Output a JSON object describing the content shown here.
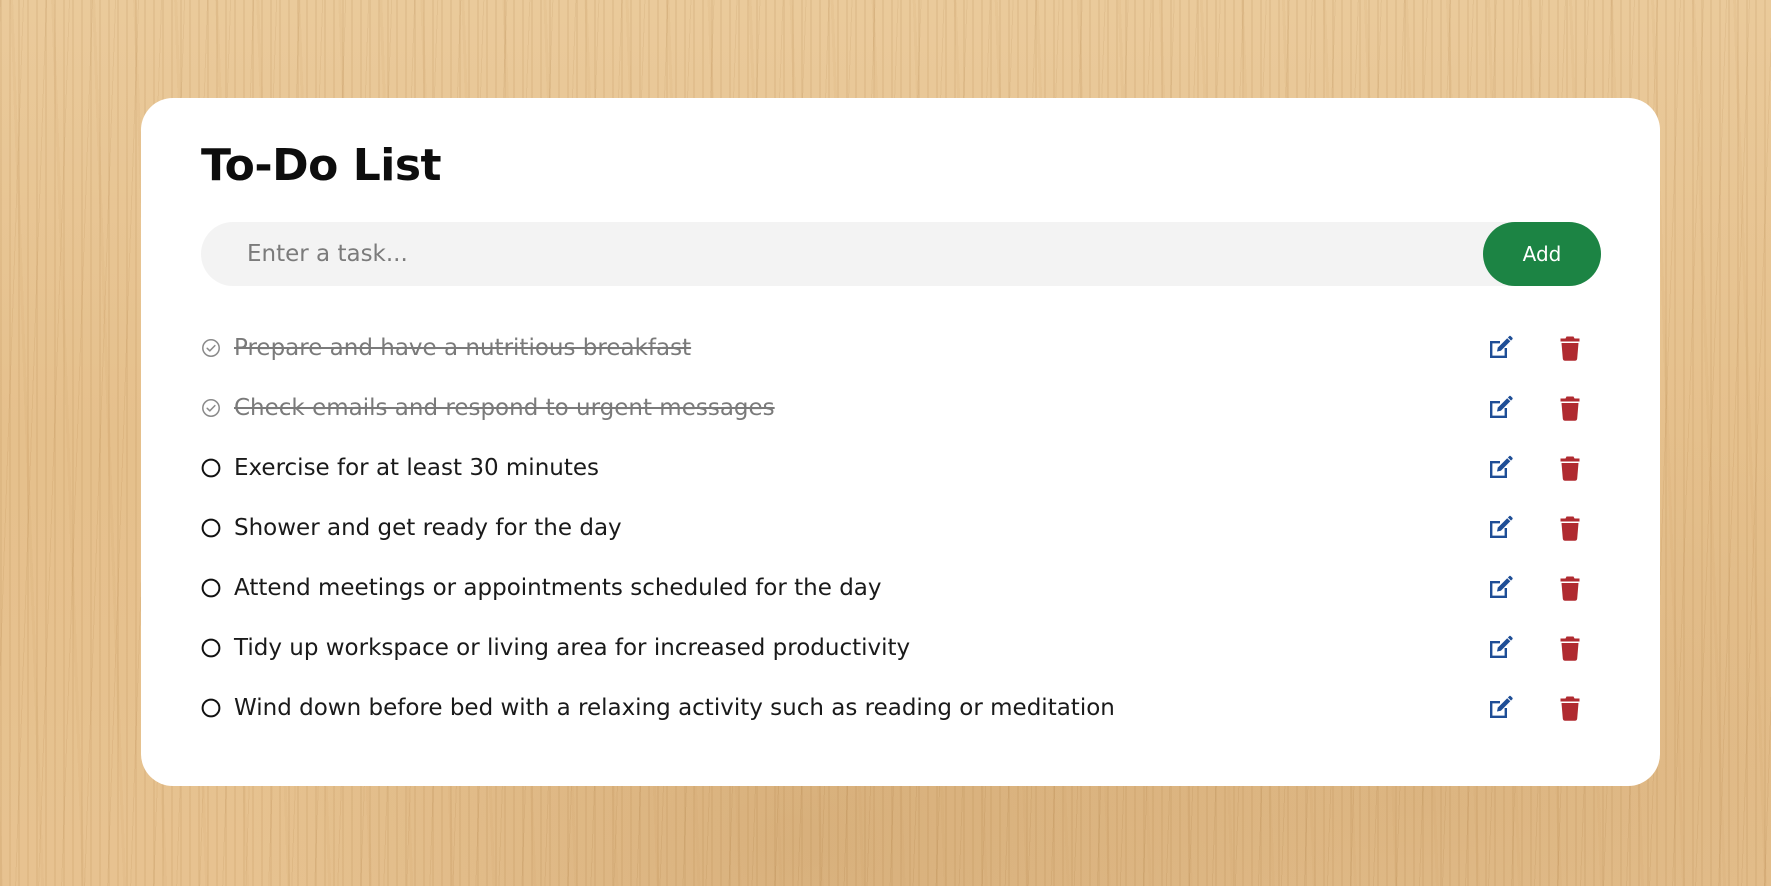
{
  "app": {
    "title": "To-Do List"
  },
  "new_task": {
    "placeholder": "Enter a task...",
    "value": "",
    "add_label": "Add"
  },
  "colors": {
    "accent": "#1c8444",
    "edit_icon": "#1f4e96",
    "delete_icon": "#b02a30",
    "done_text": "#7a7a7a"
  },
  "icons": {
    "done": "check-circle-icon",
    "pending": "circle-icon",
    "edit": "edit-icon",
    "delete": "trash-icon"
  },
  "tasks": [
    {
      "text": "Prepare and have a nutritious breakfast",
      "done": true
    },
    {
      "text": "Check emails and respond to urgent messages",
      "done": true
    },
    {
      "text": "Exercise for at least 30 minutes",
      "done": false
    },
    {
      "text": "Shower and get ready for the day",
      "done": false
    },
    {
      "text": "Attend meetings or appointments scheduled for the day",
      "done": false
    },
    {
      "text": "Tidy up workspace or living area for increased productivity",
      "done": false
    },
    {
      "text": "Wind down before bed with a relaxing activity such as reading or meditation",
      "done": false
    }
  ]
}
